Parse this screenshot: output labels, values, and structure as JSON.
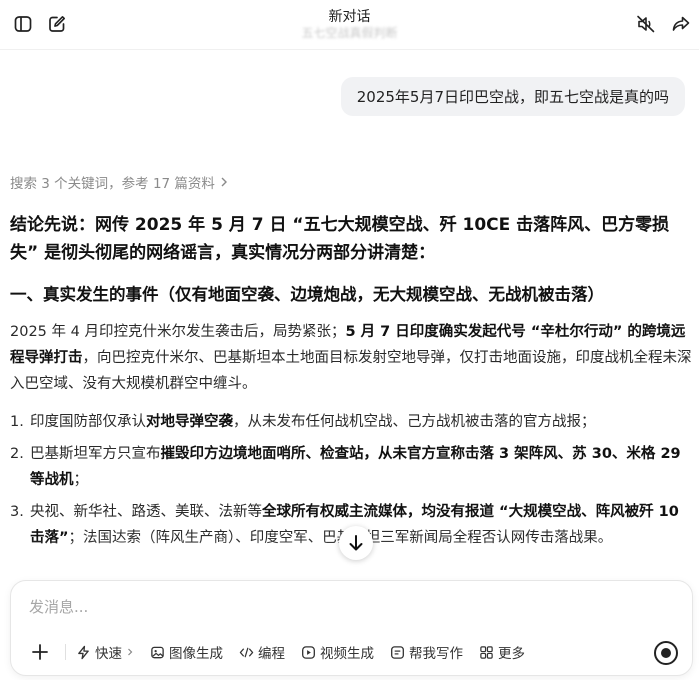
{
  "header": {
    "title": "新对话",
    "ghost_subtitle": "五七空战真假判断"
  },
  "chat": {
    "user_message": "2025年5月7日印巴空战，即五七空战是真的吗",
    "search_reference": "搜索 3 个关键词，参考 17 篇资料",
    "answer": {
      "conclusion": "结论先说：网传 2025 年 5 月 7 日 “五七大规模空战、歼 10CE 击落阵风、巴方零损失” 是彻头彻尾的网络谣言，真实情况分两部分讲清楚：",
      "section1_heading": "一、真实发生的事件（仅有地面空袭、边境炮战，无大规模空战、无战机被击落）",
      "paragraph": {
        "part1": "2025 年 4 月印控克什米尔发生袭击后，局势紧张；",
        "part2_bold": "5 月 7 日印度确实发起代号 “辛杜尔行动” 的跨境远程导弹打击",
        "part3": "，向巴控克什米尔、巴基斯坦本土地面目标发射空地导弹，仅打击地面设施，印度战机全程未深入巴空域、没有大规模机群空中缠斗。"
      },
      "list": [
        {
          "num": "1.",
          "a": "印度国防部仅承认",
          "b_bold": "对地导弹空袭",
          "c": "，从未发布任何战机空战、己方战机被击落的官方战报；"
        },
        {
          "num": "2.",
          "a": "巴基斯坦军方只宣布",
          "b_bold": "摧毁印方边境地面哨所、检查站，从未官方宣称击落 3 架阵风、苏 30、米格 29 等战机",
          "c": "；"
        },
        {
          "num": "3.",
          "a": "央视、新华社、路透、美联、法新等",
          "b_bold": "全球所有权威主流媒体，均没有报道 “大规模空战、阵风被歼 10 击落”",
          "c": "；法国达索（阵风生产商）、印度空军、巴基斯坦三军新闻局全程否认网传击落战果。"
        }
      ]
    }
  },
  "composer": {
    "placeholder": "发消息...",
    "tools": [
      {
        "icon": "lightning-icon",
        "label": "快速",
        "has_chevron": true
      },
      {
        "icon": "image-icon",
        "label": "图像生成"
      },
      {
        "icon": "code-icon",
        "label": "编程"
      },
      {
        "icon": "video-icon",
        "label": "视频生成"
      },
      {
        "icon": "pen-icon",
        "label": "帮我写作"
      },
      {
        "icon": "grid-icon",
        "label": "更多"
      }
    ]
  }
}
